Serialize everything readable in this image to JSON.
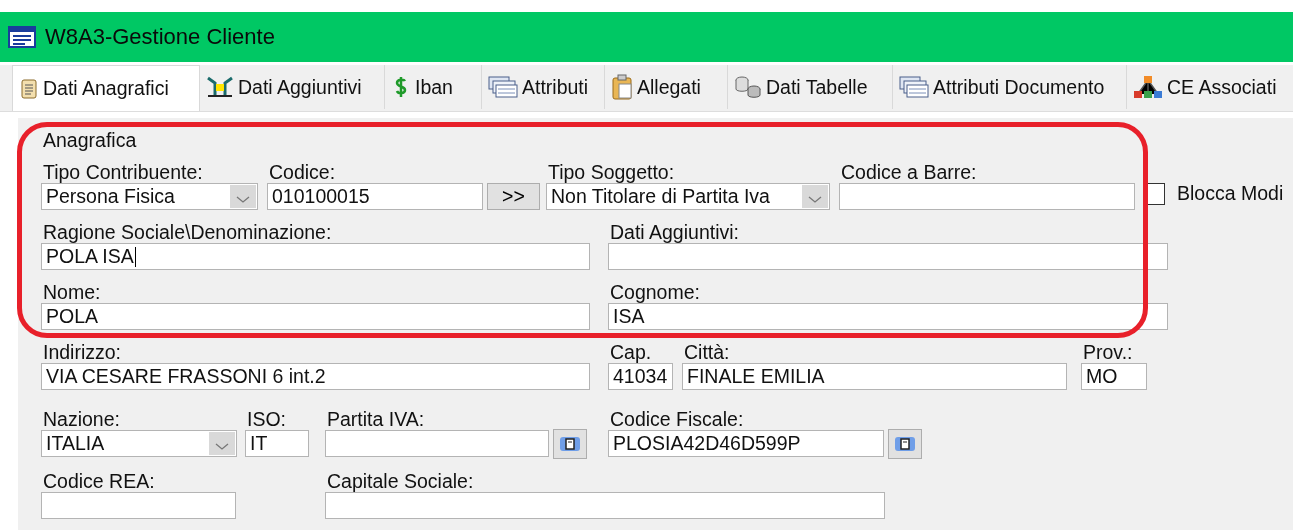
{
  "window": {
    "title": "W8A3-Gestione Cliente"
  },
  "tabs": [
    {
      "label": "Dati Anagrafici",
      "selected": true
    },
    {
      "label": "Dati Aggiuntivi",
      "selected": false
    },
    {
      "label": "Iban",
      "selected": false
    },
    {
      "label": "Attributi",
      "selected": false
    },
    {
      "label": "Allegati",
      "selected": false
    },
    {
      "label": "Dati Tabelle",
      "selected": false
    },
    {
      "label": "Attributi Documento",
      "selected": false
    },
    {
      "label": "CE Associati",
      "selected": false
    }
  ],
  "group": {
    "title": "Anagrafica"
  },
  "rows": [
    {
      "fields": [
        {
          "kind": "combo",
          "label": "Tipo Contribuente:",
          "value": "Persona Fisica"
        },
        {
          "kind": "text",
          "label": "Codice:",
          "value": "010100015"
        },
        {
          "kind": "button",
          "text": ">>"
        },
        {
          "kind": "combo",
          "label": "Tipo Soggetto:",
          "value": "Non Titolare di Partita Iva"
        },
        {
          "kind": "text",
          "label": "Codice a Barre:"
        },
        {
          "kind": "check",
          "label": "Blocca Modi",
          "checked": false
        }
      ]
    },
    {
      "fields": [
        {
          "kind": "text",
          "label": "Ragione Sociale\\Denominazione:",
          "value": "POLA ISA",
          "focused": true
        },
        {
          "kind": "text",
          "label": "Dati Aggiuntivi:"
        }
      ]
    },
    {
      "fields": [
        {
          "kind": "text",
          "label": "Nome:",
          "value": "POLA"
        },
        {
          "kind": "text",
          "label": "Cognome:",
          "value": "ISA"
        }
      ]
    },
    {
      "fields": [
        {
          "kind": "text",
          "label": "Indirizzo:",
          "value": "VIA CESARE FRASSONI 6 int.2"
        },
        {
          "kind": "text",
          "label": "Cap.",
          "value": "41034"
        },
        {
          "kind": "text",
          "label": "Città:",
          "value": "FINALE EMILIA"
        },
        {
          "kind": "text",
          "label": "Prov.:",
          "value": "MO"
        }
      ]
    },
    {
      "fields": [
        {
          "kind": "combo",
          "label": "Nazione:",
          "value": "ITALIA"
        },
        {
          "kind": "text",
          "label": "ISO:",
          "value": "IT"
        },
        {
          "kind": "lookup",
          "label": "Partita  IVA:"
        },
        {
          "kind": "lookup",
          "label": "Codice Fiscale:",
          "value": "PLOSIA42D46D599P"
        }
      ]
    },
    {
      "fields": [
        {
          "kind": "text",
          "label": "Codice REA:"
        },
        {
          "kind": "text",
          "label": "Capitale Sociale:"
        }
      ]
    }
  ]
}
